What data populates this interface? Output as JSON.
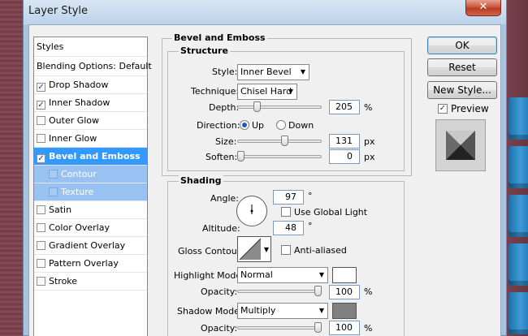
{
  "window": {
    "title": "Layer Style",
    "close_glyph": "✕"
  },
  "sidebar": {
    "header": "Styles",
    "blending": "Blending Options: Default",
    "items": [
      {
        "label": "Drop Shadow",
        "checked": true
      },
      {
        "label": "Inner Shadow",
        "checked": true
      },
      {
        "label": "Outer Glow",
        "checked": false
      },
      {
        "label": "Inner Glow",
        "checked": false
      },
      {
        "label": "Bevel and Emboss",
        "checked": true
      },
      {
        "label": "Contour",
        "checked": false
      },
      {
        "label": "Texture",
        "checked": false
      },
      {
        "label": "Satin",
        "checked": false
      },
      {
        "label": "Color Overlay",
        "checked": false
      },
      {
        "label": "Gradient Overlay",
        "checked": false
      },
      {
        "label": "Pattern Overlay",
        "checked": false
      },
      {
        "label": "Stroke",
        "checked": false
      }
    ]
  },
  "panel": {
    "title": "Bevel and Emboss",
    "structure": {
      "title": "Structure",
      "style_label": "Style:",
      "style_value": "Inner Bevel",
      "technique_label": "Technique:",
      "technique_value": "Chisel Hard",
      "depth_label": "Depth:",
      "depth_value": "205",
      "depth_unit": "%",
      "direction_label": "Direction:",
      "direction_up": "Up",
      "direction_down": "Down",
      "size_label": "Size:",
      "size_value": "131",
      "size_unit": "px",
      "soften_label": "Soften:",
      "soften_value": "0",
      "soften_unit": "px"
    },
    "shading": {
      "title": "Shading",
      "angle_label": "Angle:",
      "angle_value": "97",
      "angle_unit": "°",
      "global_light": "Use Global Light",
      "altitude_label": "Altitude:",
      "altitude_value": "48",
      "altitude_unit": "°",
      "gloss_label": "Gloss Contour:",
      "anti_aliased": "Anti-aliased",
      "highlight_mode_label": "Highlight Mode:",
      "highlight_mode_value": "Normal",
      "highlight_color": "#ffffff",
      "opacity_label": "Opacity:",
      "highlight_opacity": "100",
      "opacity_unit": "%",
      "shadow_mode_label": "Shadow Mode:",
      "shadow_mode_value": "Multiply",
      "shadow_color": "#808080",
      "shadow_opacity": "100"
    }
  },
  "buttons": {
    "ok": "OK",
    "reset": "Reset",
    "new_style": "New Style...",
    "preview": "Preview"
  },
  "colors": {
    "selected": "#3399ff",
    "sub_selected": "#99c2f2"
  }
}
